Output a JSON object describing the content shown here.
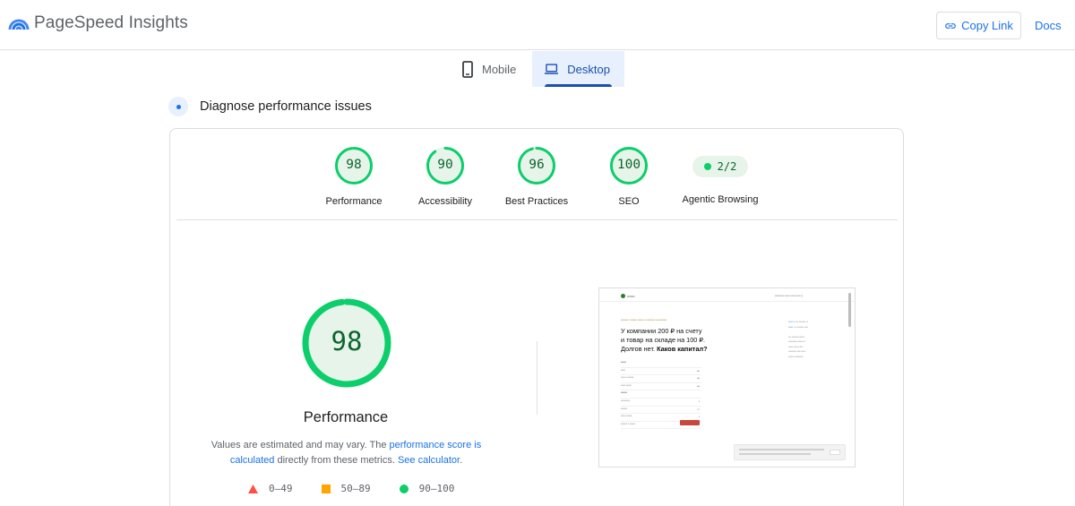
{
  "header": {
    "app_title": "PageSpeed Insights",
    "copy_link_label": "Copy Link",
    "docs_label": "Docs",
    "brand_colors": [
      "#4285f4",
      "#1a73e8"
    ]
  },
  "tabs": [
    {
      "label": "Mobile",
      "icon": "smartphone-icon",
      "selected": false
    },
    {
      "label": "Desktop",
      "icon": "desktop-icon",
      "selected": true
    }
  ],
  "section": {
    "title": "Diagnose performance issues"
  },
  "scores": [
    {
      "label": "Performance",
      "value": "98",
      "score": 98
    },
    {
      "label": "Accessibility",
      "value": "90",
      "score": 90
    },
    {
      "label": "Best Practices",
      "value": "96",
      "score": 96
    },
    {
      "label": "SEO",
      "value": "100",
      "score": 100
    }
  ],
  "agentic": {
    "label": "Agentic Browsing",
    "value": "2/2"
  },
  "performance_detail": {
    "score_text": "98",
    "score": 98,
    "title": "Performance",
    "desc_part1": "Values are estimated and may vary. The ",
    "desc_link1": "performance score is calculated",
    "desc_part2": " directly from these metrics. ",
    "desc_link2": "See calculator",
    "desc_part3": "."
  },
  "legend": [
    {
      "range": "0–49",
      "shape": "triangle",
      "color": "#ff4e42"
    },
    {
      "range": "50–89",
      "shape": "square",
      "color": "#ffa400"
    },
    {
      "range": "90–100",
      "shape": "circle",
      "color": "#0cce6b"
    }
  ],
  "colors": {
    "pass_stroke": "#0cce6b",
    "pass_fill": "#e6f4ea",
    "pass_text": "#0d652d",
    "link": "#1a73e8",
    "tab_selected_bg": "#e8f0fe"
  },
  "screenshot": {
    "heading_line1": "У компании 200 ₽ на счету",
    "heading_line2": "и товар на складе на 100 ₽.",
    "heading_line3_plain": "Долгов нет. ",
    "heading_line3_bold": "Каков капитал?"
  }
}
